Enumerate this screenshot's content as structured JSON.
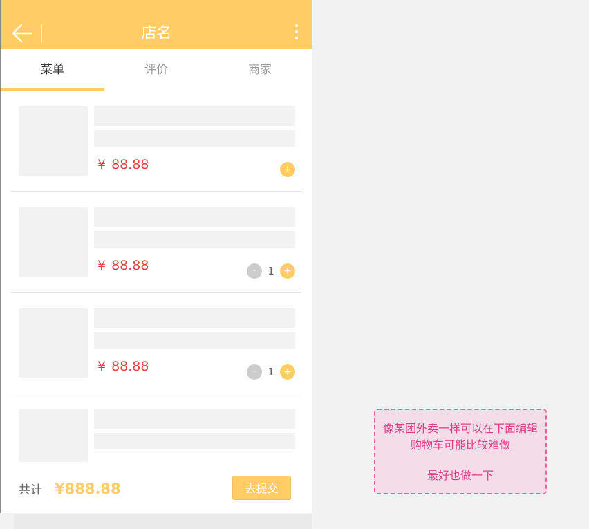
{
  "header": {
    "title": "店名"
  },
  "tabs": [
    {
      "label": "菜单",
      "active": true
    },
    {
      "label": "评价",
      "active": false
    },
    {
      "label": "商家",
      "active": false
    }
  ],
  "currency_symbol": "¥",
  "items": [
    {
      "price": "88.88",
      "quantity": null
    },
    {
      "price": "88.88",
      "quantity": "1"
    },
    {
      "price": "88.88",
      "quantity": "1"
    },
    {
      "price": "",
      "quantity": null
    }
  ],
  "controls": {
    "plus": "+",
    "minus": "-"
  },
  "footer": {
    "total_label": "共计",
    "total_value": "¥888.88",
    "submit_label": "去提交"
  },
  "note": {
    "line1": "像某团外卖一样可以在下面编辑",
    "line2": "购物车可能比较难做",
    "line3": "最好也做一下"
  },
  "colors": {
    "accent": "#ffcc66",
    "price": "#e64340",
    "note_border": "#e8619c"
  }
}
